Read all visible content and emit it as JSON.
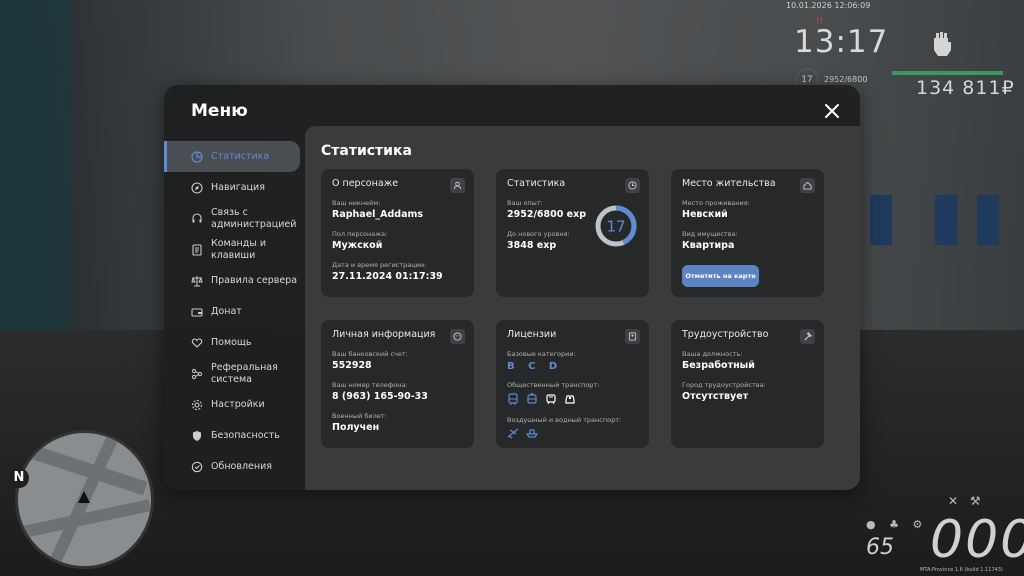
{
  "hud": {
    "datetime": "10.01.2026 12:06:09",
    "time": "13:17",
    "alert": "!!",
    "level": "17",
    "exp": "2952/6800",
    "money": "134 811₽",
    "speed": "000",
    "fuel": "65",
    "compass": "N",
    "build": "MTA:Province 1.6 (build 1.11743)"
  },
  "menu": {
    "title": "Меню",
    "sidebar": [
      {
        "label": "Статистика",
        "icon": "chart-pie-icon",
        "active": true
      },
      {
        "label": "Навигация",
        "icon": "compass-icon"
      },
      {
        "label": "Связь с администрацией",
        "icon": "headset-icon"
      },
      {
        "label": "Команды и клавиши",
        "icon": "document-icon"
      },
      {
        "label": "Правила сервера",
        "icon": "scales-icon"
      },
      {
        "label": "Донат",
        "icon": "wallet-icon"
      },
      {
        "label": "Помощь",
        "icon": "heart-hand-icon"
      },
      {
        "label": "Реферальная система",
        "icon": "network-icon"
      },
      {
        "label": "Настройки",
        "icon": "gear-icon"
      },
      {
        "label": "Безопасность",
        "icon": "shield-icon"
      },
      {
        "label": "Обновления",
        "icon": "refresh-icon"
      }
    ]
  },
  "content": {
    "title": "Статистика",
    "character": {
      "title": "О персонаже",
      "nickname_label": "Ваш никнейм:",
      "nickname": "Raphael_Addams",
      "gender_label": "Пол персонажа:",
      "gender": "Мужской",
      "reg_label": "Дата и время регистрации:",
      "reg": "27.11.2024 01:17:39"
    },
    "stats": {
      "title": "Статистика",
      "exp_label": "Ваш опыт:",
      "exp": "2952/6800 exp",
      "next_label": "До нового уровня:",
      "next": "3848 exp",
      "level": "17",
      "progress": 0.434
    },
    "residence": {
      "title": "Место жительства",
      "place_label": "Место проживания:",
      "place": "Невский",
      "type_label": "Вид имущества:",
      "type": "Квартира",
      "button": "Отметить на карте"
    },
    "personal": {
      "title": "Личная информация",
      "bank_label": "Ваш банковский счет:",
      "bank": "552928",
      "phone_label": "Ваш номер телефона:",
      "phone": "8 (963) 165-90-33",
      "military_label": "Военный билет:",
      "military": "Получен"
    },
    "licenses": {
      "title": "Лицензии",
      "base_label": "Базовые категории:",
      "base": "B C D",
      "public_label": "Общественный транспорт:",
      "air_label": "Воздушный и водный транспорт:"
    },
    "job": {
      "title": "Трудоустройство",
      "position_label": "Ваша должность:",
      "position": "Безработный",
      "city_label": "Город трудоустройства:",
      "city": "Отсутствует"
    }
  },
  "colors": {
    "accent": "#5d8bd4",
    "hp": "#3a9a5b"
  }
}
